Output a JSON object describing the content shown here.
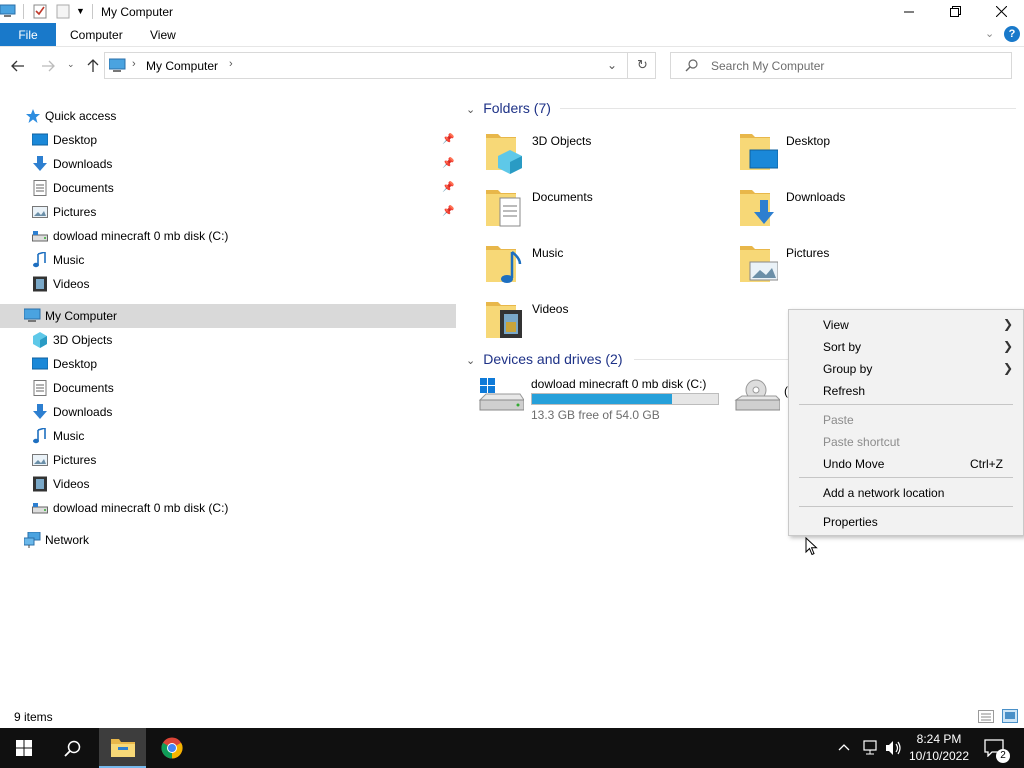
{
  "window": {
    "title": "My Computer",
    "colors": {
      "accent": "#1979ca",
      "select_bg": "#d9d9d9",
      "header": "#1e3287"
    }
  },
  "ribbon": {
    "file": "File",
    "tabs": [
      "Computer",
      "View"
    ]
  },
  "address": {
    "path": "My Computer",
    "search_placeholder": "Search My Computer"
  },
  "nav": {
    "quick_access": "Quick access",
    "quick_items": [
      {
        "label": "Desktop",
        "icon": "desktop-icon",
        "pinned": true
      },
      {
        "label": "Downloads",
        "icon": "downloads-icon",
        "pinned": true
      },
      {
        "label": "Documents",
        "icon": "documents-icon",
        "pinned": true
      },
      {
        "label": "Pictures",
        "icon": "pictures-icon",
        "pinned": true
      },
      {
        "label": "dowload minecraft 0 mb disk (C:)",
        "icon": "drive-icon",
        "pinned": false
      },
      {
        "label": "Music",
        "icon": "music-icon",
        "pinned": false
      },
      {
        "label": "Videos",
        "icon": "videos-icon",
        "pinned": false
      }
    ],
    "this_pc": "My Computer",
    "pc_items": [
      {
        "label": "3D Objects",
        "icon": "3d-objects-icon"
      },
      {
        "label": "Desktop",
        "icon": "desktop-icon"
      },
      {
        "label": "Documents",
        "icon": "documents-icon"
      },
      {
        "label": "Downloads",
        "icon": "downloads-icon"
      },
      {
        "label": "Music",
        "icon": "music-icon"
      },
      {
        "label": "Pictures",
        "icon": "pictures-icon"
      },
      {
        "label": "Videos",
        "icon": "videos-icon"
      },
      {
        "label": "dowload minecraft 0 mb disk (C:)",
        "icon": "drive-icon"
      }
    ],
    "network": "Network"
  },
  "content": {
    "folders_header": "Folders (7)",
    "folders": [
      "3D Objects",
      "Desktop",
      "Documents",
      "Downloads",
      "Music",
      "Pictures",
      "Videos"
    ],
    "devices_header": "Devices and drives (2)",
    "drive": {
      "name": "dowload minecraft 0 mb disk (C:)",
      "free": "13.3 GB free of 54.0 GB",
      "used_fraction": 0.754
    },
    "drive2_partial": "("
  },
  "context_menu": {
    "items": [
      {
        "label": "View",
        "submenu": true,
        "enabled": true
      },
      {
        "label": "Sort by",
        "submenu": true,
        "enabled": true
      },
      {
        "label": "Group by",
        "submenu": true,
        "enabled": true
      },
      {
        "label": "Refresh",
        "enabled": true
      },
      {
        "label": "Paste",
        "enabled": false
      },
      {
        "label": "Paste shortcut",
        "enabled": false
      },
      {
        "label": "Undo Move",
        "shortcut": "Ctrl+Z",
        "enabled": true
      },
      {
        "label": "Add a network location",
        "enabled": true
      },
      {
        "label": "Properties",
        "enabled": true
      }
    ]
  },
  "status": {
    "items": "9 items"
  },
  "taskbar": {
    "time": "8:24 PM",
    "date": "10/10/2022",
    "notifications": "2"
  }
}
